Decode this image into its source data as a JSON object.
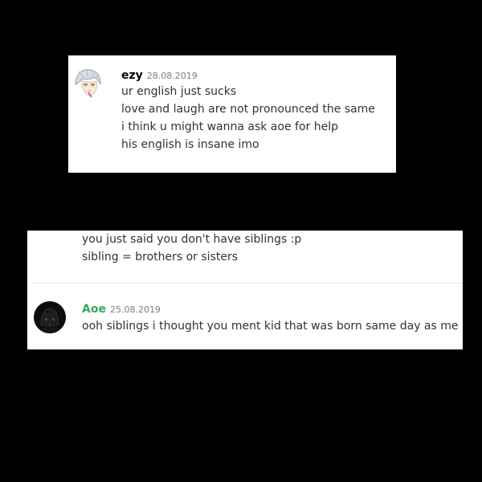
{
  "top_message": {
    "username": "ezy",
    "timestamp": "28.08.2019",
    "lines": [
      "ur english just sucks",
      "love and laugh are not pronounced the same",
      "i think u might wanna ask aoe for help",
      "his english is insane imo"
    ]
  },
  "bottom_panel": {
    "continued_lines": [
      "you just said you don't have siblings :p",
      "sibling = brothers or sisters"
    ],
    "message": {
      "username": "Aoe",
      "timestamp": "25.08.2019",
      "lines": [
        "ooh siblings i thought you ment kid that was born same day as me"
      ]
    }
  },
  "colors": {
    "background": "#000000",
    "panel": "#ffffff",
    "username_aoe": "#3ba55c",
    "timestamp": "#747f8d",
    "message_text": "#2e3338"
  },
  "icons": {
    "avatar_ezy": "anime-avatar-icon",
    "avatar_aoe": "dark-mask-avatar-icon"
  }
}
